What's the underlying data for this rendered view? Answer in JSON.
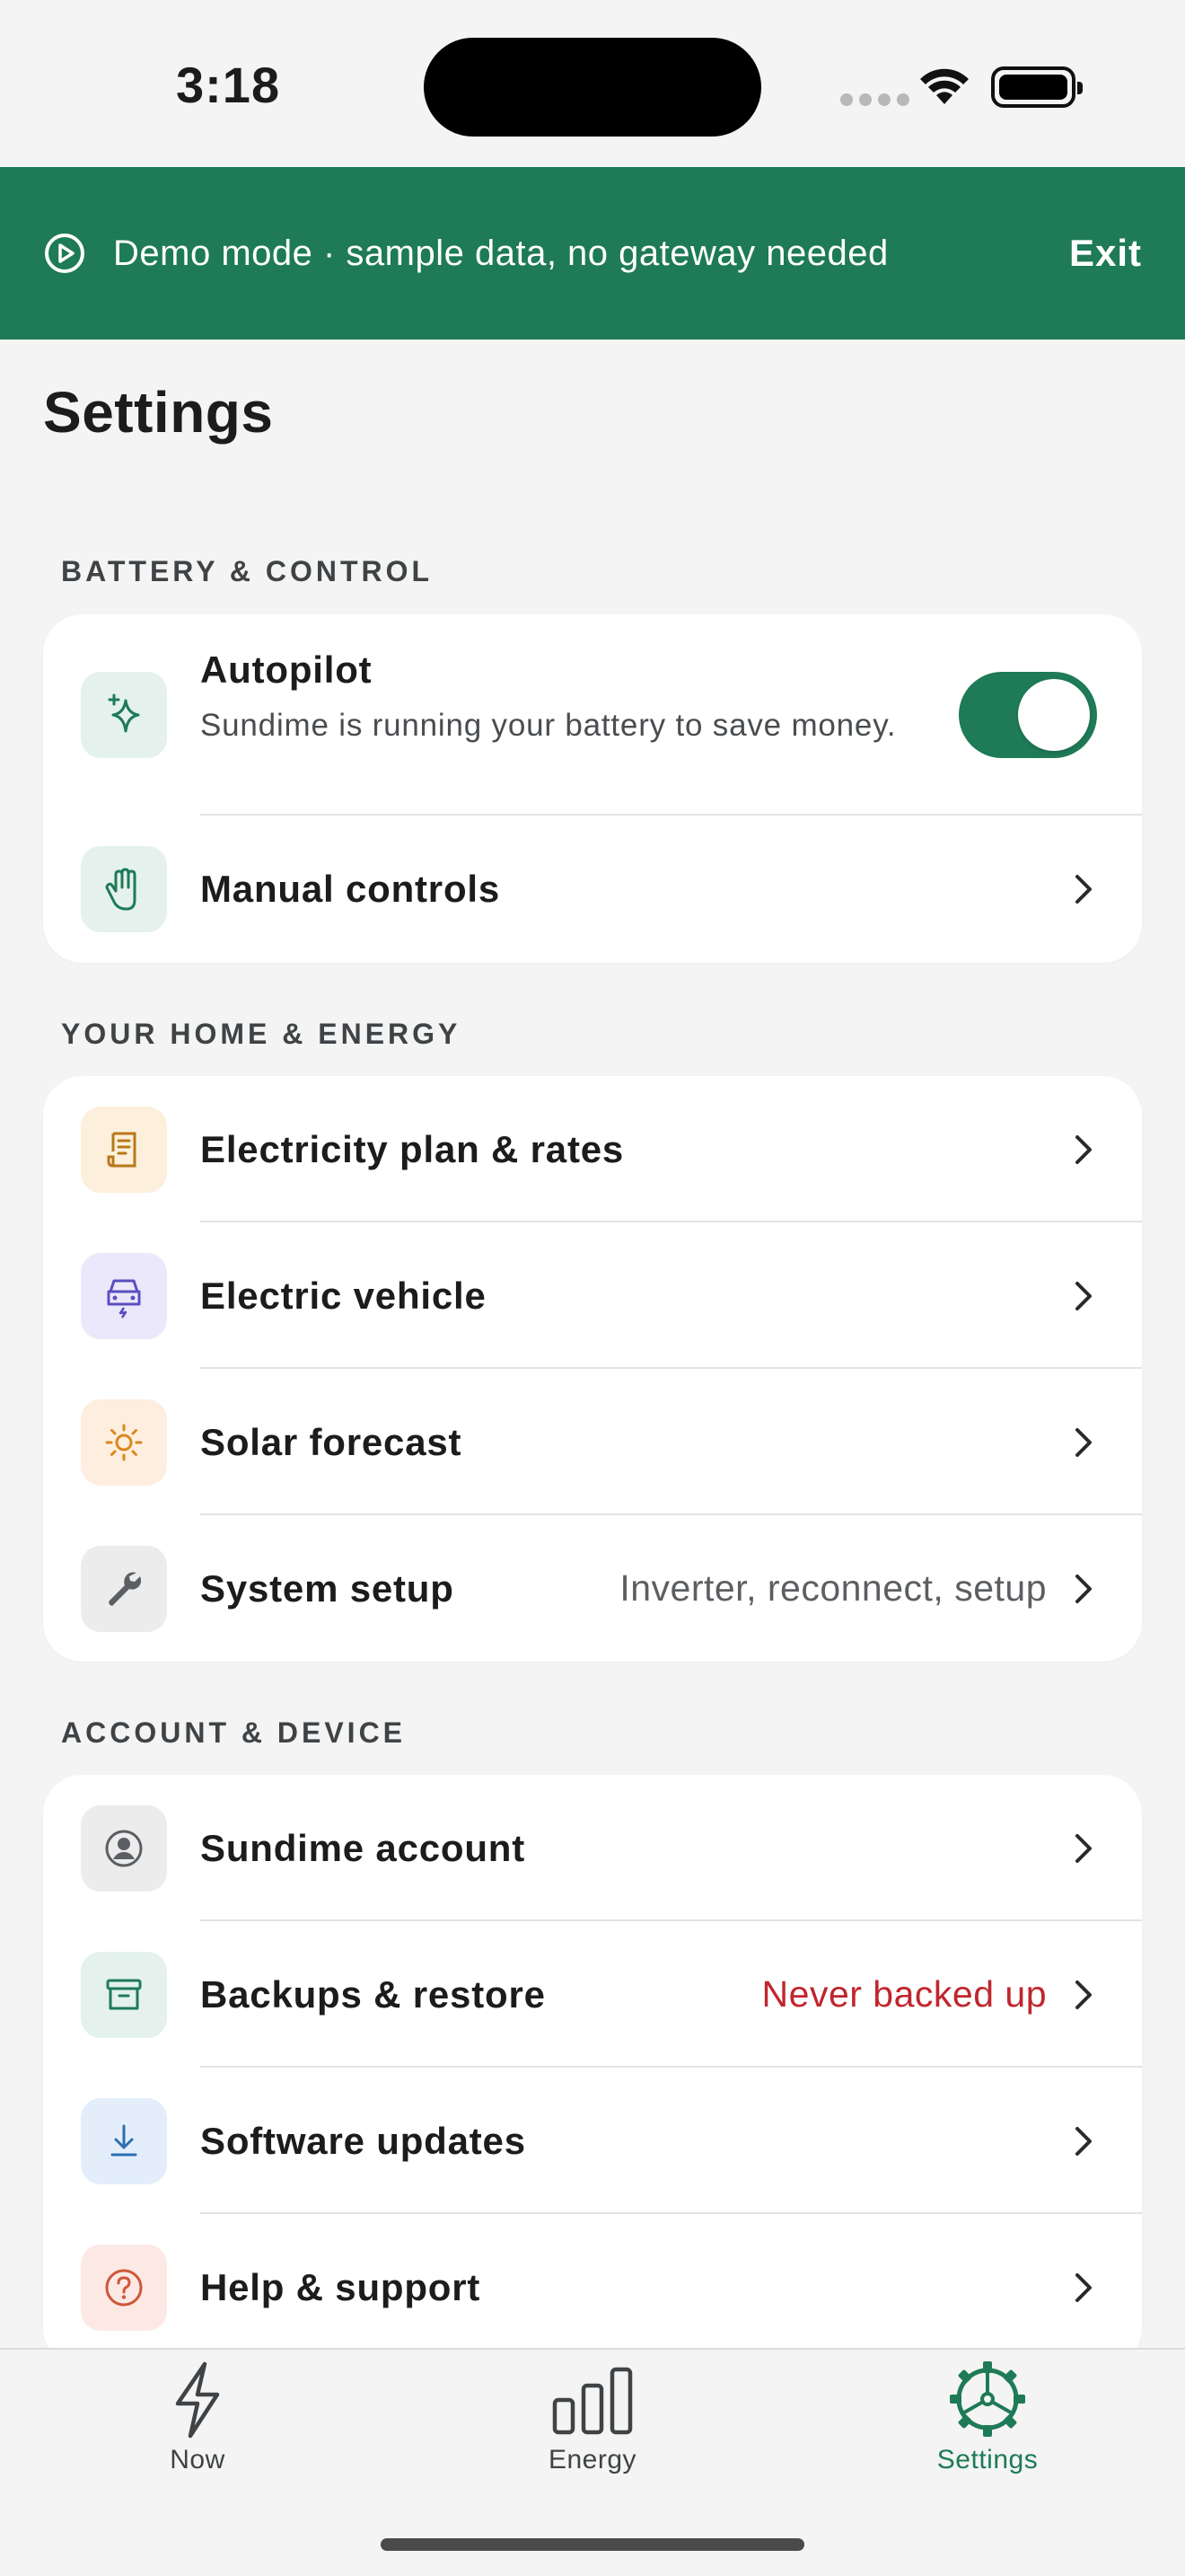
{
  "status_bar": {
    "time": "3:18"
  },
  "banner": {
    "message": "Demo mode · sample data, no gateway needed",
    "exit_label": "Exit"
  },
  "page": {
    "title": "Settings"
  },
  "sections": {
    "battery": {
      "header": "BATTERY & CONTROL",
      "autopilot": {
        "label": "Autopilot",
        "description": "Sundime is running your battery to save money.",
        "enabled": true
      },
      "manual": {
        "label": "Manual controls"
      }
    },
    "home": {
      "header": "YOUR HOME & ENERGY",
      "items": [
        {
          "label": "Electricity plan & rates",
          "value": "",
          "icon": "receipt-icon"
        },
        {
          "label": "Electric vehicle",
          "value": "",
          "icon": "car-icon"
        },
        {
          "label": "Solar forecast",
          "value": "",
          "icon": "sun-icon"
        },
        {
          "label": "System setup",
          "value": "Inverter, reconnect, setup",
          "icon": "wrench-icon"
        }
      ]
    },
    "account": {
      "header": "ACCOUNT & DEVICE",
      "items": [
        {
          "label": "Sundime account",
          "value": "",
          "icon": "person-icon"
        },
        {
          "label": "Backups & restore",
          "value": "Never backed up",
          "icon": "archive-icon"
        },
        {
          "label": "Software updates",
          "value": "",
          "icon": "download-icon"
        },
        {
          "label": "Help & support",
          "value": "",
          "icon": "help-icon"
        }
      ]
    }
  },
  "tabs": [
    {
      "label": "Now",
      "icon": "bolt-icon"
    },
    {
      "label": "Energy",
      "icon": "bar-chart-icon"
    },
    {
      "label": "Settings",
      "icon": "gear-icon",
      "active": true
    }
  ],
  "colors": {
    "brand": "#1e7a57",
    "alert": "#c0262d",
    "background": "#f3f4f3"
  }
}
